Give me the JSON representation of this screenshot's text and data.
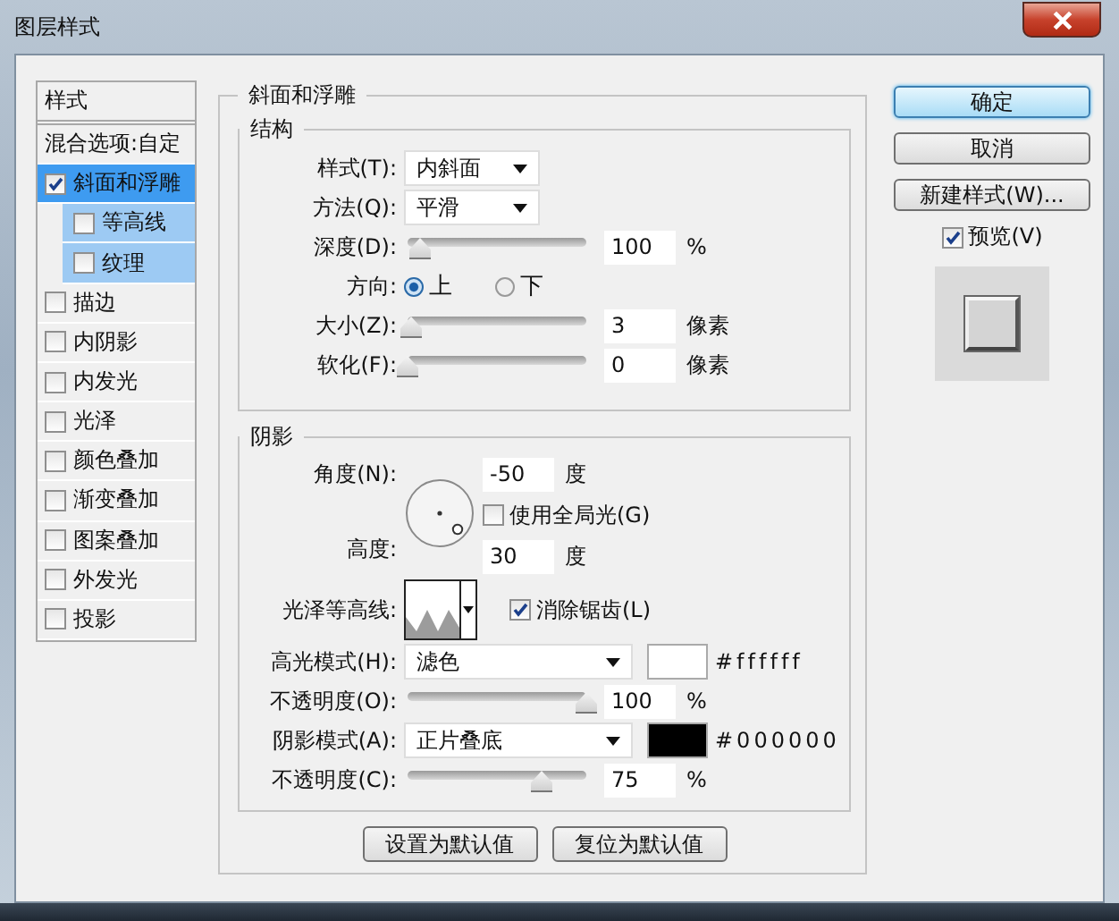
{
  "window": {
    "title": "图层样式"
  },
  "sidebar": {
    "header": "样式",
    "items": [
      {
        "label": "混合选项:自定",
        "kind": "plain",
        "selected": false
      },
      {
        "label": "斜面和浮雕",
        "kind": "check",
        "checked": true,
        "selected": true,
        "children": [
          {
            "label": "等高线",
            "kind": "check",
            "checked": false,
            "selected": false
          },
          {
            "label": "纹理",
            "kind": "check",
            "checked": false,
            "selected": false
          }
        ]
      },
      {
        "label": "描边",
        "kind": "check",
        "checked": false,
        "selected": false
      },
      {
        "label": "内阴影",
        "kind": "check",
        "checked": false,
        "selected": false
      },
      {
        "label": "内发光",
        "kind": "check",
        "checked": false,
        "selected": false
      },
      {
        "label": "光泽",
        "kind": "check",
        "checked": false,
        "selected": false
      },
      {
        "label": "颜色叠加",
        "kind": "check",
        "checked": false,
        "selected": false
      },
      {
        "label": "渐变叠加",
        "kind": "check",
        "checked": false,
        "selected": false
      },
      {
        "label": "图案叠加",
        "kind": "check",
        "checked": false,
        "selected": false
      },
      {
        "label": "外发光",
        "kind": "check",
        "checked": false,
        "selected": false
      },
      {
        "label": "投影",
        "kind": "check",
        "checked": false,
        "selected": false
      }
    ]
  },
  "panel": {
    "title": "斜面和浮雕",
    "structure": {
      "title": "结构",
      "rows": [
        {
          "kind": "dropdown",
          "label": "样式(T):",
          "value": "内斜面"
        },
        {
          "kind": "dropdown",
          "label": "方法(Q):",
          "value": "平滑"
        },
        {
          "kind": "slider",
          "label": "深度(D):",
          "level": 0.07,
          "value": "100",
          "unit": "%"
        },
        {
          "kind": "radio",
          "label": "方向:",
          "options": [
            {
              "label": "上",
              "selected": true
            },
            {
              "label": "下",
              "selected": false
            }
          ]
        },
        {
          "kind": "slider",
          "label": "大小(Z):",
          "level": 0.02,
          "value": "3",
          "unit": "像素"
        },
        {
          "kind": "slider",
          "label": "软化(F):",
          "level": 0.0,
          "value": "0",
          "unit": "像素"
        }
      ]
    },
    "shading": {
      "title": "阴影",
      "angle": {
        "label": "角度(N):",
        "value": "-50",
        "unit": "度"
      },
      "global_light": {
        "label": "使用全局光(G)",
        "checked": false
      },
      "altitude": {
        "label": "高度:",
        "value": "30",
        "unit": "度"
      },
      "gloss_contour": {
        "label": "光泽等高线:"
      },
      "anti_alias": {
        "label": "消除锯齿(L)",
        "checked": true
      },
      "rows": [
        {
          "kind": "mode",
          "label": "高光模式(H):",
          "value": "滤色",
          "color": "#ffffff",
          "hex": "#ffffff"
        },
        {
          "kind": "slider",
          "label": "不透明度(O):",
          "level": 1.0,
          "value": "100",
          "unit": "%"
        },
        {
          "kind": "mode",
          "label": "阴影模式(A):",
          "value": "正片叠底",
          "color": "#000000",
          "hex": "#000000"
        },
        {
          "kind": "slider",
          "label": "不透明度(C):",
          "level": 0.75,
          "value": "75",
          "unit": "%"
        }
      ]
    },
    "buttons": [
      "设置为默认值",
      "复位为默认值"
    ]
  },
  "actions": [
    {
      "label": "确定",
      "default": true
    },
    {
      "label": "取消",
      "default": false
    },
    {
      "label": "新建样式(W)...",
      "default": false
    }
  ],
  "preview": {
    "label": "预览(V)",
    "checked": true
  }
}
